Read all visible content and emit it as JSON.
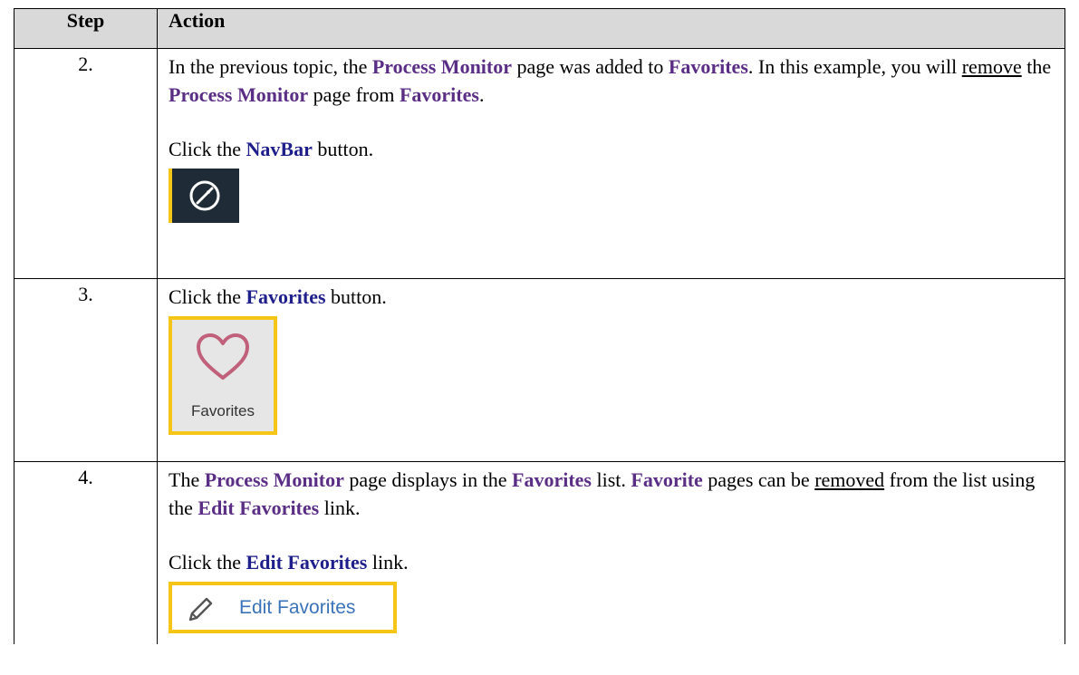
{
  "table": {
    "header_step": "Step",
    "header_action": "Action"
  },
  "rows": [
    {
      "step": "2.",
      "para1": {
        "t1": "In the previous topic, the ",
        "b1": "Process Monitor",
        "t2": " page was added to ",
        "b2": "Favorites",
        "t3": ". In this example, you will ",
        "u1": "remove",
        "t4": " the ",
        "b3": "Process Monitor",
        "t5": " page from ",
        "b4": "Favorites",
        "t6": "."
      },
      "para2": {
        "t1": "Click the ",
        "b1": "NavBar",
        "t2": " button."
      },
      "image_icon": "compass-icon"
    },
    {
      "step": "3.",
      "para1": {
        "t1": "Click the ",
        "b1": "Favorites",
        "t2": " button."
      },
      "image_label": "Favorites",
      "image_icon": "heart-icon"
    },
    {
      "step": "4.",
      "para1": {
        "t1": "The ",
        "b1": "Process Monitor",
        "t2": " page displays in the ",
        "b2": "Favorites",
        "t3": " list. ",
        "b3": "Favorite",
        "t4": " pages can be ",
        "u1": "removed",
        "t5": " from the list using the ",
        "b4": "Edit Favorites",
        "t6": " link."
      },
      "para2": {
        "t1": "Click the ",
        "b1": "Edit Favorites",
        "t2": " link."
      },
      "image_label": "Edit Favorites",
      "image_icon": "pencil-icon"
    }
  ],
  "colors": {
    "header_bg": "#d9d9d9",
    "bold_link_blue": "#1f1f8c",
    "bold_purple": "#5b2e86",
    "highlight_yellow": "#f5c518",
    "navbar_bg": "#1f2b36",
    "heart_pink": "#c0607a",
    "edit_blue": "#3b73b9"
  }
}
